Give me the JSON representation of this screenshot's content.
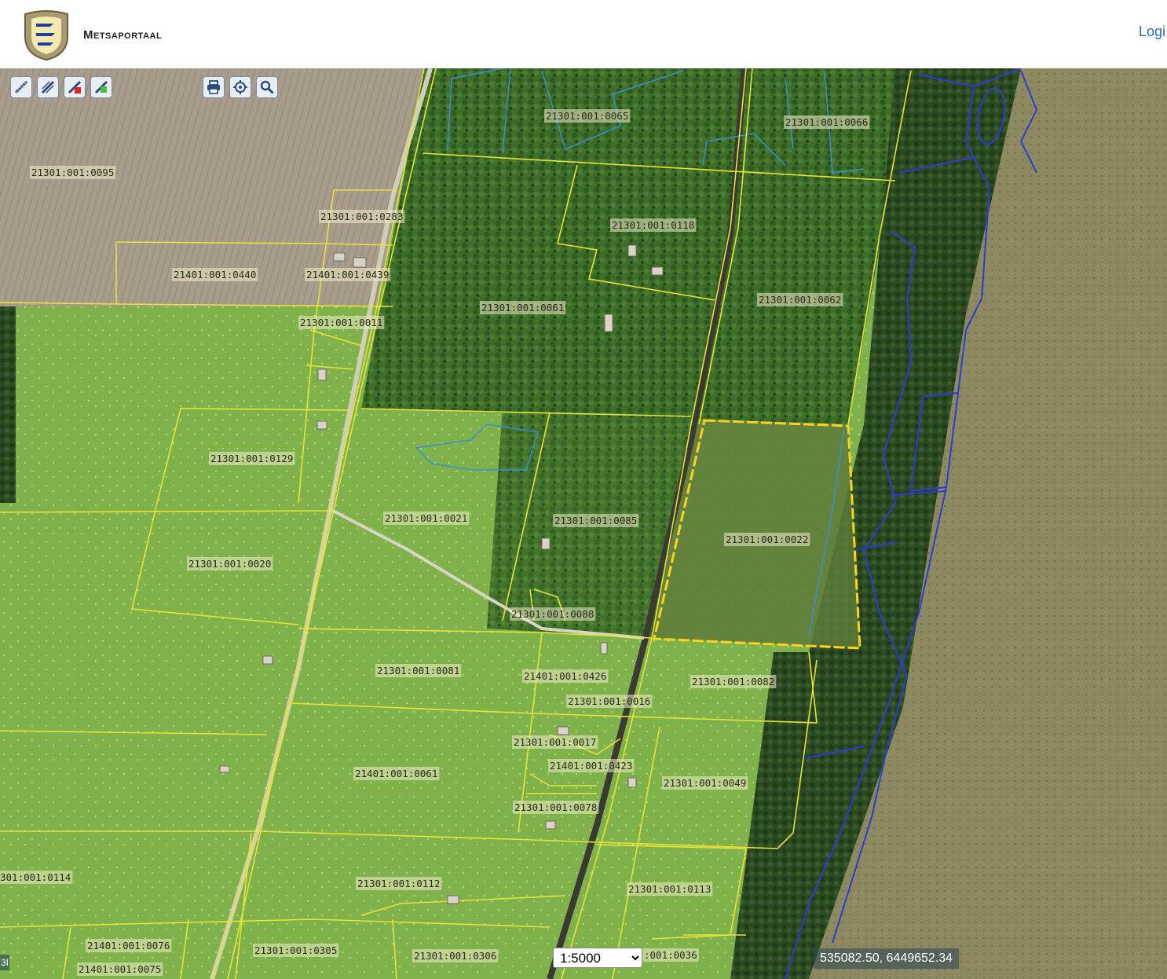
{
  "header": {
    "brand": "Metsaportaal",
    "login_label": "Logi"
  },
  "toolbar_left": [
    {
      "name": "measure-line-tool",
      "icon": "ruler-icon"
    },
    {
      "name": "measure-area-tool",
      "icon": "area-measure-icon"
    },
    {
      "name": "draw-red-tool",
      "icon": "draw-marker-red-icon"
    },
    {
      "name": "draw-green-tool",
      "icon": "draw-marker-green-icon"
    }
  ],
  "toolbar_right": [
    {
      "name": "print-button",
      "icon": "printer-icon"
    },
    {
      "name": "locate-button",
      "icon": "crosshair-icon"
    },
    {
      "name": "search-button",
      "icon": "magnifier-icon"
    }
  ],
  "map": {
    "scale": "1:5000",
    "scale_options": [
      "1:5000"
    ],
    "coordinates": "535082.50, 6449652.34",
    "attribution_fragment": "3I",
    "colors": {
      "parcel_border": "#e8e23a",
      "selected_parcel": "#ffd21f",
      "forest_compartment": "#2b3bd6",
      "stand_border": "#3a8fd0"
    },
    "parcels": [
      {
        "id": "21301:001:0095"
      },
      {
        "id": "21301:001:0065"
      },
      {
        "id": "21301:001:0066"
      },
      {
        "id": "21301:001:0283"
      },
      {
        "id": "21301:001:0118"
      },
      {
        "id": "21401:001:0440"
      },
      {
        "id": "21401:001:0439"
      },
      {
        "id": "21301:001:0061"
      },
      {
        "id": "21301:001:0062"
      },
      {
        "id": "21301:001:0011"
      },
      {
        "id": "21301:001:0129"
      },
      {
        "id": "21301:001:0021"
      },
      {
        "id": "21301:001:0085"
      },
      {
        "id": "21301:001:0022"
      },
      {
        "id": "21301:001:0020"
      },
      {
        "id": "21301:001:0088"
      },
      {
        "id": "21301:001:0081"
      },
      {
        "id": "21401:001:0426"
      },
      {
        "id": "21301:001:0082"
      },
      {
        "id": "21301:001:0016"
      },
      {
        "id": "21301:001:0017"
      },
      {
        "id": "21401:001:0423"
      },
      {
        "id": "21401:001:0061"
      },
      {
        "id": "21301:001:0049"
      },
      {
        "id": "21301:001:0078"
      },
      {
        "id": "301:001:0114"
      },
      {
        "id": "21301:001:0112"
      },
      {
        "id": "21301:001:0113"
      },
      {
        "id": "21401:001:0076"
      },
      {
        "id": "21301:001:0305"
      },
      {
        "id": "21301:001:0306"
      },
      {
        "id": ":001:0036"
      },
      {
        "id": "21401:001:0075"
      }
    ]
  }
}
